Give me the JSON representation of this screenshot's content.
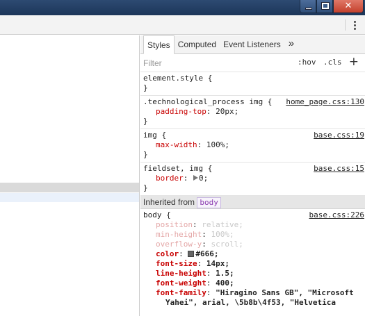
{
  "titlebar": {
    "close_glyph": "✕"
  },
  "toolbar": {
    "more_icon": "kebab-menu-icon"
  },
  "tabs": [
    {
      "label": "Styles",
      "active": true
    },
    {
      "label": "Computed",
      "active": false
    },
    {
      "label": "Event Listeners",
      "active": false
    },
    {
      "label": "»",
      "active": false
    }
  ],
  "filter": {
    "placeholder": "Filter",
    "hov": ":hov",
    "cls": ".cls",
    "plus": "+"
  },
  "rules": {
    "r0": {
      "selector": "element.style {",
      "close": "}"
    },
    "r1": {
      "selector": ".technological_process img {",
      "source": "home_page.css:130",
      "decls": [
        {
          "name": "padding-top",
          "value": " 20px;"
        }
      ],
      "close": "}"
    },
    "r2": {
      "selector": "img {",
      "source": "base.css:19",
      "decls": [
        {
          "name": "max-width",
          "value": " 100%;"
        }
      ],
      "close": "}"
    },
    "r3": {
      "selector": "fieldset, img {",
      "source": "base.css:15",
      "decls": [
        {
          "name": "border",
          "value": "0;"
        }
      ],
      "close": "}"
    }
  },
  "inherited": {
    "label": "Inherited from",
    "tag": "body"
  },
  "body_rule": {
    "selector": "body {",
    "source": "base.css:226",
    "decls": [
      {
        "name": "position",
        "value": " relative;"
      },
      {
        "name": "min-height",
        "value": " 100%;"
      },
      {
        "name": "overflow-y",
        "value": " scroll;"
      },
      {
        "name": "color",
        "value": "#666;",
        "swatch": "#666666"
      },
      {
        "name": "font-size",
        "value": " 14px;"
      },
      {
        "name": "line-height",
        "value": " 1.5;"
      },
      {
        "name": "font-weight",
        "value": " 400;"
      },
      {
        "name": "font-family",
        "value": " \"Hiragino Sans GB\", \"Microsoft"
      }
    ],
    "wrap_line": "Yahei\", arial, \\5b8b\\4f53, \"Helvetica"
  },
  "colors": {
    "titlebar": "#1f3a5f",
    "property_name": "#c80000",
    "inherited_tag": "#8a3ab0"
  }
}
